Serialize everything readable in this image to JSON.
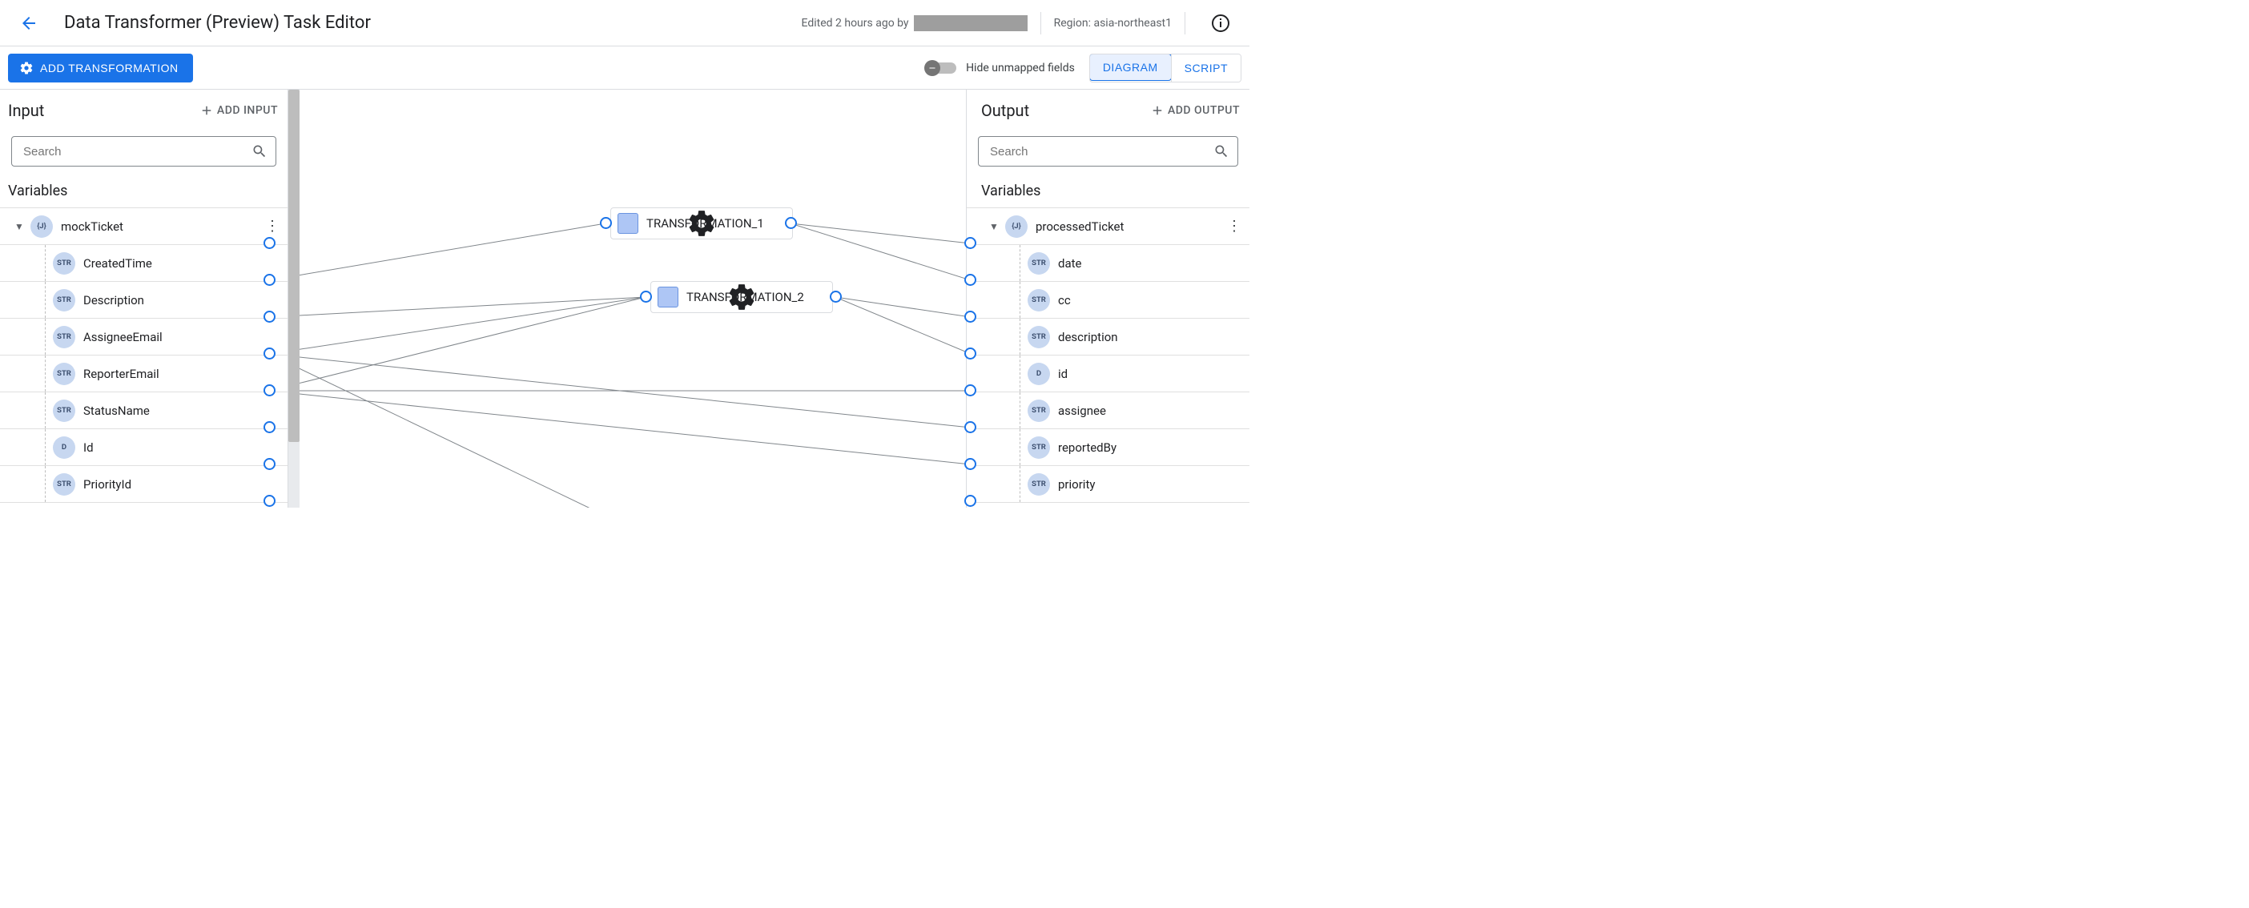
{
  "header": {
    "title": "Data Transformer (Preview) Task Editor",
    "edited_prefix": "Edited 2 hours ago by",
    "region_label": "Region: asia-northeast1"
  },
  "toolbar": {
    "add_transformation": "ADD TRANSFORMATION",
    "hide_unmapped": "Hide unmapped fields",
    "view_diagram": "DIAGRAM",
    "view_script": "SCRIPT"
  },
  "input_panel": {
    "title": "Input",
    "add_btn": "ADD INPUT",
    "search_placeholder": "Search",
    "variables_label": "Variables",
    "root": {
      "type": "{J}",
      "name": "mockTicket"
    },
    "fields": [
      {
        "type": "STR",
        "name": "CreatedTime"
      },
      {
        "type": "STR",
        "name": "Description"
      },
      {
        "type": "STR",
        "name": "AssigneeEmail"
      },
      {
        "type": "STR",
        "name": "ReporterEmail"
      },
      {
        "type": "STR",
        "name": "StatusName"
      },
      {
        "type": "D",
        "name": "Id"
      },
      {
        "type": "STR",
        "name": "PriorityId"
      }
    ]
  },
  "output_panel": {
    "title": "Output",
    "add_btn": "ADD OUTPUT",
    "search_placeholder": "Search",
    "variables_label": "Variables",
    "root": {
      "type": "{J}",
      "name": "processedTicket"
    },
    "fields": [
      {
        "type": "STR",
        "name": "date"
      },
      {
        "type": "STR",
        "name": "cc"
      },
      {
        "type": "STR",
        "name": "description"
      },
      {
        "type": "D",
        "name": "id"
      },
      {
        "type": "STR",
        "name": "assignee"
      },
      {
        "type": "STR",
        "name": "reportedBy"
      },
      {
        "type": "STR",
        "name": "priority"
      }
    ]
  },
  "transformations": [
    {
      "name": "TRANSFORMATION_1"
    },
    {
      "name": "TRANSFORMATION_2"
    }
  ]
}
